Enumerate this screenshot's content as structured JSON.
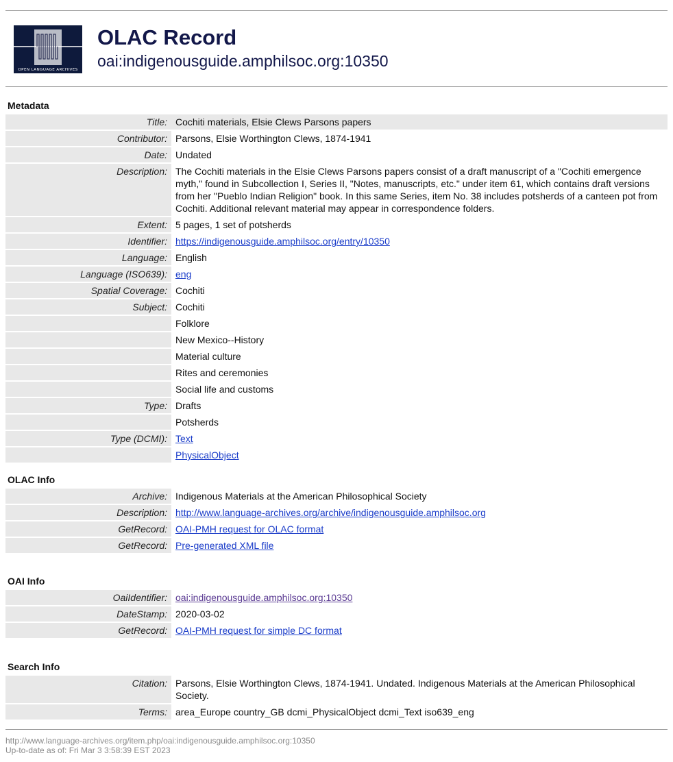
{
  "header": {
    "title": "OLAC Record",
    "subtitle": "oai:indigenousguide.amphilsoc.org:10350",
    "logo_text": "OPEN LANGUAGE ARCHIVES"
  },
  "metadata": {
    "heading": "Metadata",
    "title_label": "Title:",
    "title": "Cochiti materials, Elsie Clews Parsons papers",
    "contributor_label": "Contributor:",
    "contributor": "Parsons, Elsie Worthington Clews, 1874-1941",
    "date_label": "Date:",
    "date": "Undated",
    "description_label": "Description:",
    "description": "The Cochiti materials in the Elsie Clews Parsons papers consist of a draft manuscript of a \"Cochiti emergence myth,\" found in Subcollection I, Series II, \"Notes, manuscripts, etc.\" under item 61, which contains draft versions from her \"Pueblo Indian Religion\" book. In this same Series, item No. 38 includes potsherds of a canteen pot from Cochiti. Additional relevant material may appear in correspondence folders.",
    "extent_label": "Extent:",
    "extent": "5 pages, 1 set of potsherds",
    "identifier_label": "Identifier:",
    "identifier": "https://indigenousguide.amphilsoc.org/entry/10350",
    "language_label": "Language:",
    "language": "English",
    "language_iso_label": "Language (ISO639):",
    "language_iso": "eng",
    "spatial_label": "Spatial Coverage:",
    "spatial": "Cochiti",
    "subject_label": "Subject:",
    "subjects": [
      "Cochiti",
      "Folklore",
      "New Mexico--History",
      "Material culture",
      "Rites and ceremonies",
      "Social life and customs"
    ],
    "type_label": "Type:",
    "types": [
      "Drafts",
      "Potsherds"
    ],
    "type_dcmi_label": "Type (DCMI):",
    "types_dcmi": [
      "Text",
      "PhysicalObject"
    ]
  },
  "olac_info": {
    "heading": "OLAC Info",
    "archive_label": "Archive:",
    "archive": "Indigenous Materials at the American Philosophical Society",
    "description_label": "Description:",
    "description": "http://www.language-archives.org/archive/indigenousguide.amphilsoc.org",
    "getrecord_label": "GetRecord:",
    "getrecord_1": "OAI-PMH request for OLAC format",
    "getrecord_2": "Pre-generated XML file"
  },
  "oai_info": {
    "heading": "OAI Info",
    "oaiidentifier_label": "OaiIdentifier:",
    "oaiidentifier": "oai:indigenousguide.amphilsoc.org:10350",
    "datestamp_label": "DateStamp:",
    "datestamp": "2020-03-02",
    "getrecord_label": "GetRecord:",
    "getrecord": "OAI-PMH request for simple DC format"
  },
  "search_info": {
    "heading": "Search Info",
    "citation_label": "Citation:",
    "citation": "Parsons, Elsie Worthington Clews, 1874-1941. Undated. Indigenous Materials at the American Philosophical Society.",
    "terms_label": "Terms:",
    "terms": "area_Europe country_GB dcmi_PhysicalObject dcmi_Text iso639_eng"
  },
  "footer": {
    "url": "http://www.language-archives.org/item.php/oai:indigenousguide.amphilsoc.org:10350",
    "updated": "Up-to-date as of: Fri Mar 3 3:58:39 EST 2023"
  },
  "colors": {
    "title": "#13184a",
    "label_bg": "#e8e8e8",
    "link": "#1a3cc9",
    "visited_link": "#5a3a92"
  }
}
